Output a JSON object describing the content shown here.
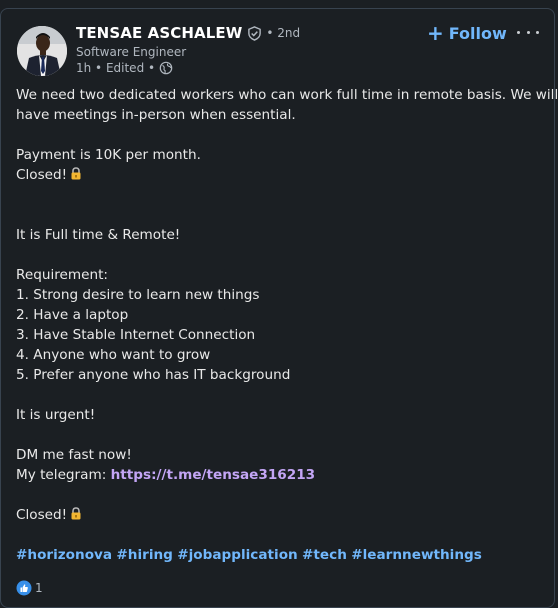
{
  "author": {
    "name": "TENSAE ASCHALEW",
    "degree": "• 2nd",
    "headline": "Software Engineer",
    "meta": "1h • Edited •"
  },
  "actions": {
    "follow_label": "Follow"
  },
  "post": {
    "line1": "We need two dedicated workers who can work full time in remote basis. We will",
    "line2": "have meetings in-person when essential.",
    "line3": "Payment is 10K per month.",
    "line4": "Closed!",
    "line5": "It is Full time & Remote!",
    "line6": "Requirement:",
    "req1": "1. Strong desire to learn new things",
    "req2": "2. Have a laptop",
    "req3": "3. Have Stable Internet Connection",
    "req4": "4. Anyone who want to grow",
    "req5": "5. Prefer anyone who has IT background",
    "line7": "It is urgent!",
    "line8": "DM me fast now!",
    "telegram_prefix": "My telegram: ",
    "telegram_link": "https://t.me/tensae316213",
    "line9": "Closed!"
  },
  "hashtags": [
    "#horizonova",
    "#hiring",
    "#jobapplication",
    "#tech",
    "#learnnewthings"
  ],
  "reactions": {
    "count": "1"
  },
  "colors": {
    "accent": "#71b7fb",
    "link": "#c3a5f5",
    "background": "#1b1f23",
    "text": "#e9e9e9",
    "muted": "#b0b7bf"
  }
}
